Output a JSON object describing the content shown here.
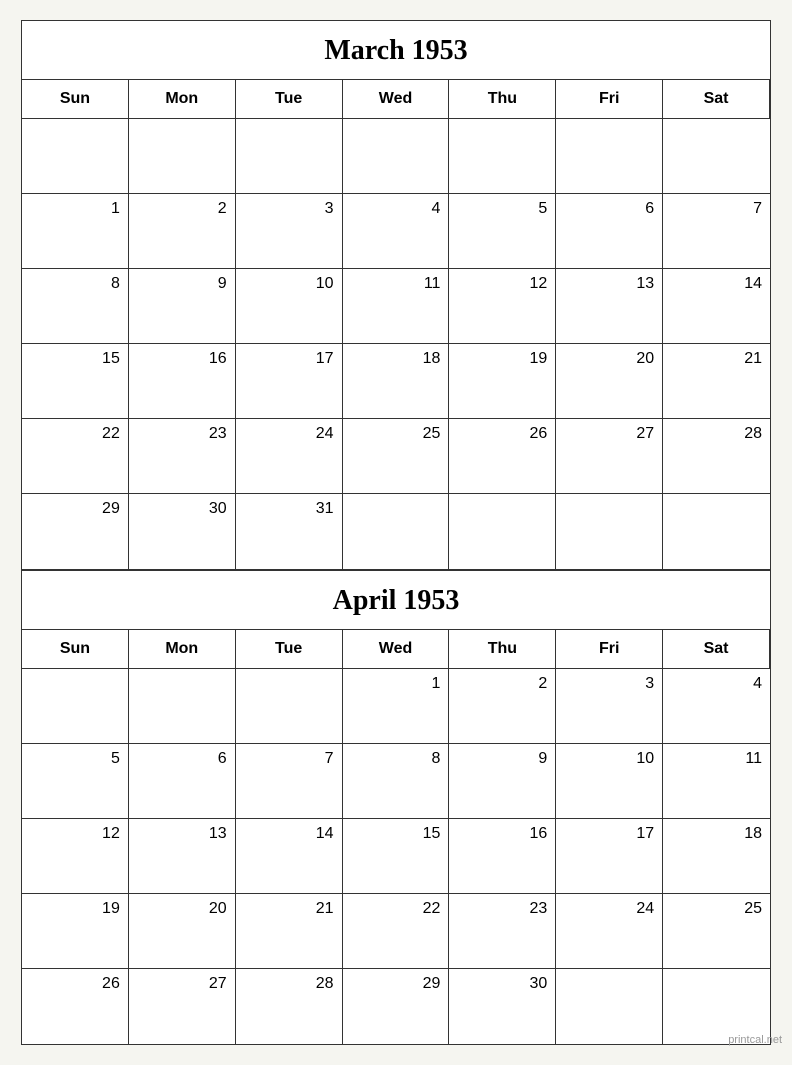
{
  "calendars": [
    {
      "id": "march-1953",
      "title": "March 1953",
      "headers": [
        "Sun",
        "Mon",
        "Tue",
        "Wed",
        "Thu",
        "Fri",
        "Sat"
      ],
      "weeks": [
        [
          null,
          null,
          null,
          null,
          null,
          null,
          null
        ],
        [
          1,
          2,
          3,
          4,
          5,
          6,
          7
        ],
        [
          8,
          9,
          10,
          11,
          12,
          13,
          14
        ],
        [
          15,
          16,
          17,
          18,
          19,
          20,
          21
        ],
        [
          22,
          23,
          24,
          25,
          26,
          27,
          28
        ],
        [
          29,
          30,
          31,
          null,
          null,
          null,
          null
        ]
      ],
      "startDay": 0,
      "totalDays": 31
    },
    {
      "id": "april-1953",
      "title": "April 1953",
      "headers": [
        "Sun",
        "Mon",
        "Tue",
        "Wed",
        "Thu",
        "Fri",
        "Sat"
      ],
      "weeks": [
        [
          null,
          null,
          null,
          1,
          2,
          3,
          4
        ],
        [
          5,
          6,
          7,
          8,
          9,
          10,
          11
        ],
        [
          12,
          13,
          14,
          15,
          16,
          17,
          18
        ],
        [
          19,
          20,
          21,
          22,
          23,
          24,
          25
        ],
        [
          26,
          27,
          28,
          29,
          30,
          null,
          null
        ]
      ],
      "startDay": 3,
      "totalDays": 30
    }
  ],
  "watermark": "printcal.net"
}
